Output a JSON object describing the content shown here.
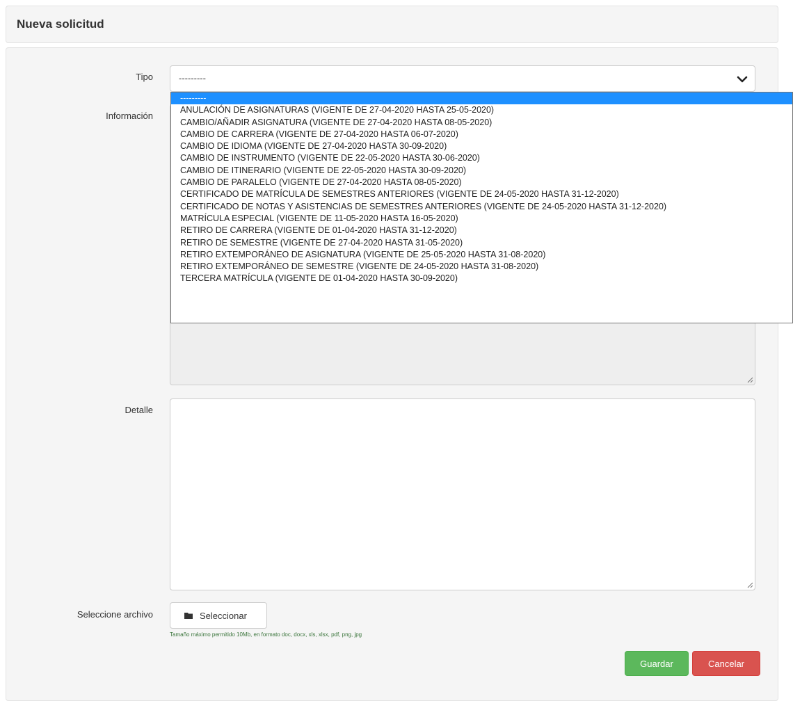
{
  "header": {
    "title": "Nueva solicitud"
  },
  "form": {
    "tipo": {
      "label": "Tipo",
      "value": "---------",
      "options": [
        "---------",
        "ANULACIÓN DE ASIGNATURAS (VIGENTE DE 27-04-2020 HASTA 25-05-2020)",
        "CAMBIO/AÑADIR ASIGNATURA (VIGENTE DE 27-04-2020 HASTA 08-05-2020)",
        "CAMBIO DE CARRERA (VIGENTE DE 27-04-2020 HASTA 06-07-2020)",
        "CAMBIO DE IDIOMA (VIGENTE DE 27-04-2020 HASTA 30-09-2020)",
        "CAMBIO DE INSTRUMENTO (VIGENTE DE 22-05-2020 HASTA 30-06-2020)",
        "CAMBIO DE ITINERARIO (VIGENTE DE 22-05-2020 HASTA 30-09-2020)",
        "CAMBIO DE PARALELO (VIGENTE DE 27-04-2020 HASTA 08-05-2020)",
        "CERTIFICADO DE MATRÍCULA DE SEMESTRES ANTERIORES (VIGENTE DE 24-05-2020 HASTA 31-12-2020)",
        "CERTIFICADO DE NOTAS Y ASISTENCIAS DE SEMESTRES ANTERIORES (VIGENTE DE 24-05-2020 HASTA 31-12-2020)",
        "MATRÍCULA ESPECIAL (VIGENTE DE 11-05-2020 HASTA 16-05-2020)",
        "RETIRO DE CARRERA (VIGENTE DE 01-04-2020 HASTA 31-12-2020)",
        "RETIRO DE SEMESTRE (VIGENTE DE 27-04-2020 HASTA 31-05-2020)",
        "RETIRO EXTEMPORÁNEO DE ASIGNATURA (VIGENTE DE 25-05-2020 HASTA 31-08-2020)",
        "RETIRO EXTEMPORÁNEO DE SEMESTRE (VIGENTE DE 24-05-2020 HASTA 31-08-2020)",
        "TERCERA MATRÍCULA (VIGENTE DE 01-04-2020 HASTA 30-09-2020)"
      ]
    },
    "informacion": {
      "label": "Información"
    },
    "detalle": {
      "label": "Detalle"
    },
    "archivo": {
      "label": "Seleccione archivo",
      "button_label": "Seleccionar",
      "hint": "Tamaño máximo permitido 10Mb, en formato doc, docx, xls, xlsx, pdf, png, jpg"
    }
  },
  "actions": {
    "save_label": "Guardar",
    "cancel_label": "Cancelar"
  },
  "colors": {
    "save": "#5cb85c",
    "cancel": "#d9534f",
    "selected_option": "#1e90ff",
    "hint": "#3c763d"
  },
  "icons": {
    "select_chevron": "chevron-down-icon",
    "file_button": "folder-icon"
  }
}
